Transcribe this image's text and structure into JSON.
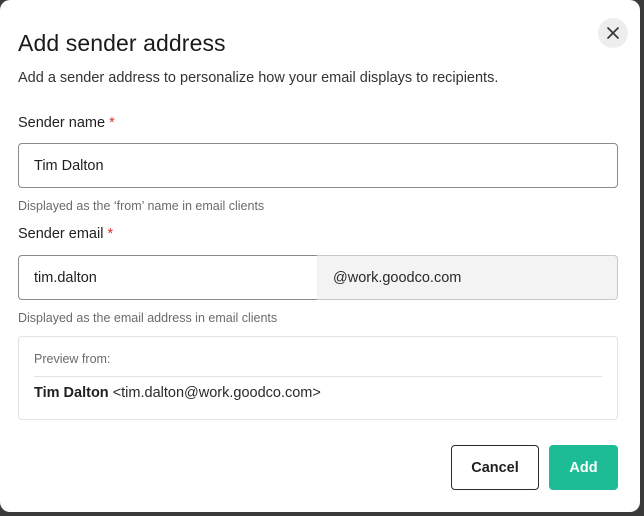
{
  "dialog": {
    "title": "Add sender address",
    "subtitle": "Add a sender address to personalize how your email displays to recipients.",
    "close_icon": "close-icon"
  },
  "sender_name": {
    "label": "Sender name",
    "required_mark": "*",
    "value": "Tim Dalton",
    "help": "Displayed as the ‘from’ name in email clients"
  },
  "sender_email": {
    "label": "Sender email",
    "required_mark": "*",
    "value": "tim.dalton",
    "domain": "@work.goodco.com",
    "help": "Displayed as the email address in email clients"
  },
  "preview": {
    "heading": "Preview from:",
    "name": "Tim Dalton",
    "address": "<tim.dalton@work.goodco.com>"
  },
  "actions": {
    "cancel_label": "Cancel",
    "add_label": "Add"
  },
  "colors": {
    "accent": "#1ebc96",
    "required": "#d93025"
  }
}
